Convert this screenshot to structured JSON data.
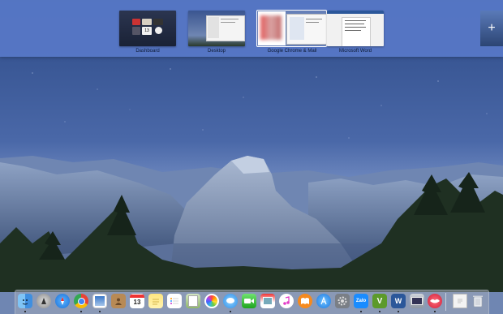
{
  "spaces": [
    {
      "label": "Dashboard"
    },
    {
      "label": "Desktop"
    },
    {
      "label": "Google Chrome & Mail"
    },
    {
      "label": "Microsoft Word"
    }
  ],
  "add_space_symbol": "+",
  "dashboard_widget_date": "13",
  "dock": {
    "calendar_day": "13",
    "zalo_label": "Zalo",
    "vim_label": "V",
    "word_label": "W",
    "items": [
      "finder-icon",
      "launchpad-icon",
      "safari-icon",
      "chrome-icon",
      "mail-stamp-icon",
      "contacts-icon",
      "calendar-icon",
      "notes-icon",
      "reminders-icon",
      "preview-icon",
      "photos-icon",
      "messages-icon",
      "facetime-icon",
      "photo-booth-icon",
      "itunes-icon",
      "ibooks-icon",
      "app-store-icon",
      "system-preferences-icon",
      "zalo-icon",
      "vim-icon",
      "word-icon",
      "image-capture-icon",
      "lips-icon",
      "document-icon",
      "trash-icon"
    ]
  }
}
